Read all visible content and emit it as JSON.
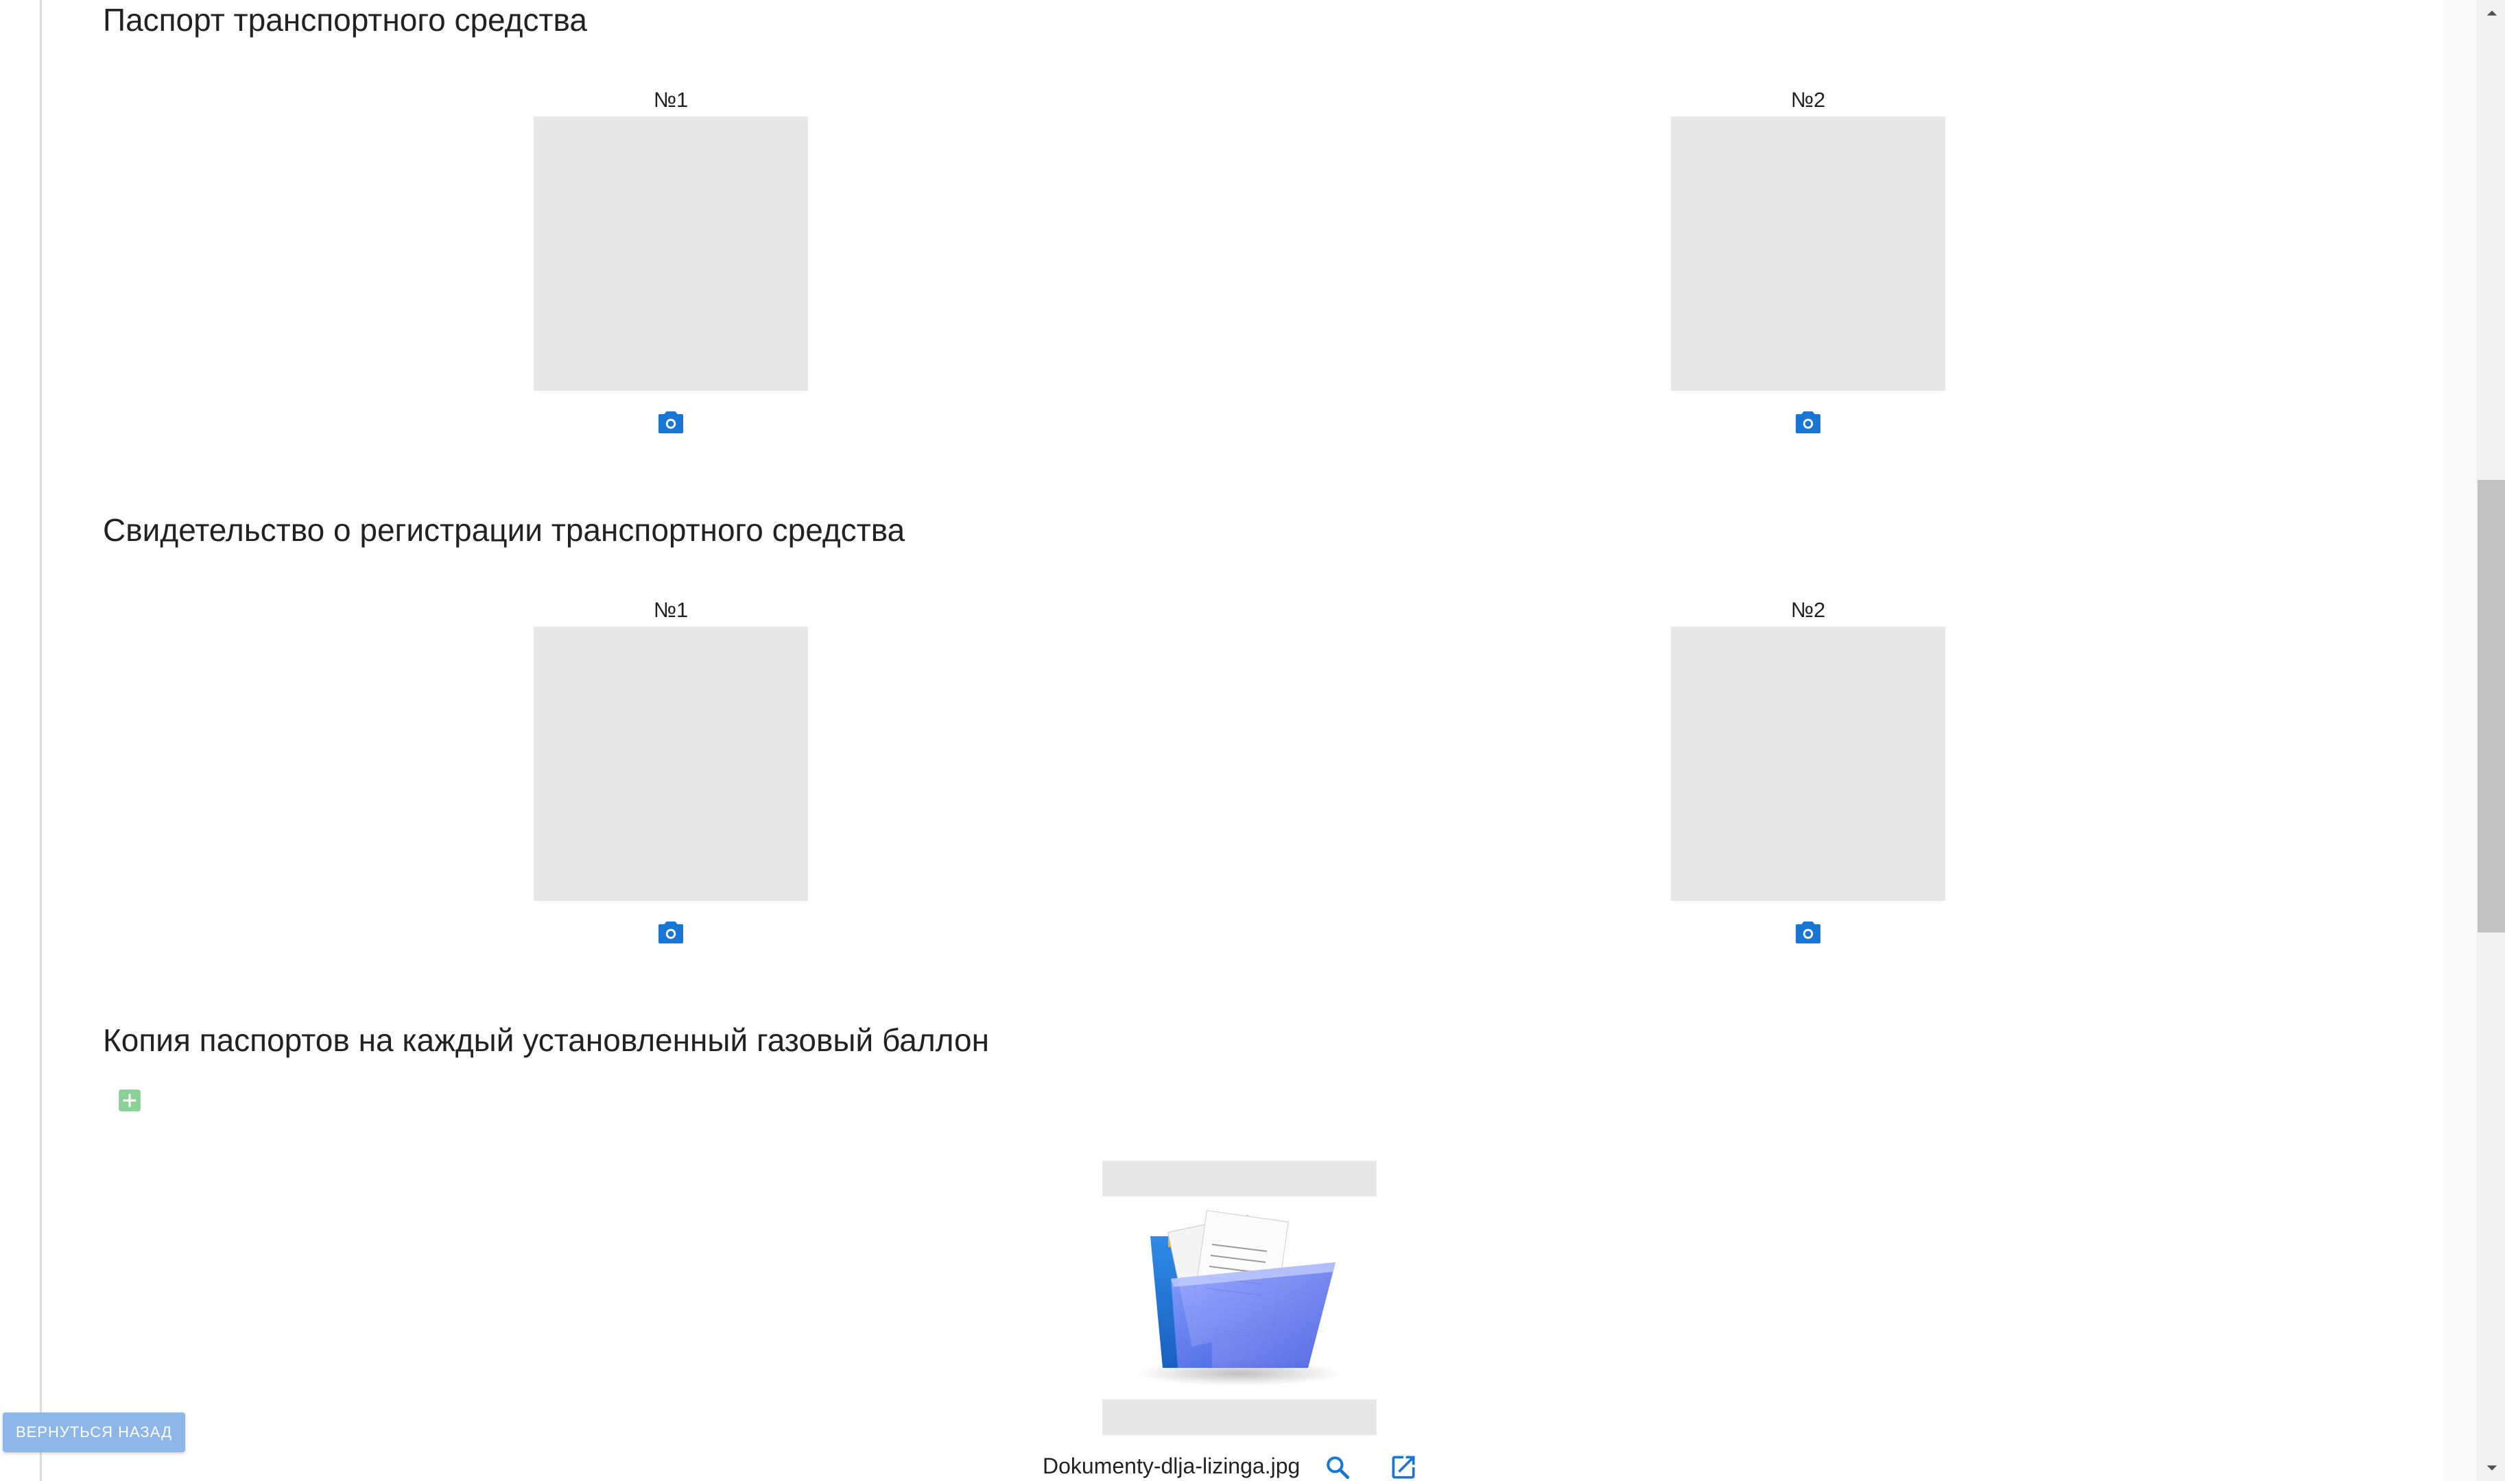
{
  "sections": [
    {
      "title": "Паспорт транспортного средства",
      "slots": [
        {
          "label": "№1"
        },
        {
          "label": "№2"
        }
      ]
    },
    {
      "title": "Свидетельство о регистрации транспортного средства",
      "slots": [
        {
          "label": "№1"
        },
        {
          "label": "№2"
        }
      ]
    },
    {
      "title": "Копия паспортов на каждый установленный газовый баллон"
    }
  ],
  "attachment": {
    "file_name": "Dokumenty-dlja-lizinga.jpg",
    "thumbnail_icon": "document-folder-icon"
  },
  "icons": {
    "camera": "camera-icon",
    "add": "add-box-icon",
    "search": "search-icon",
    "open": "open-in-new-icon"
  },
  "footer": {
    "back_label": "ВЕРНУТЬСЯ НАЗАД"
  },
  "colors": {
    "accent": "#1976d2",
    "add_green": "#8bd195",
    "placeholder": "#e7e7e7",
    "back_button": "#8cb7e8"
  }
}
